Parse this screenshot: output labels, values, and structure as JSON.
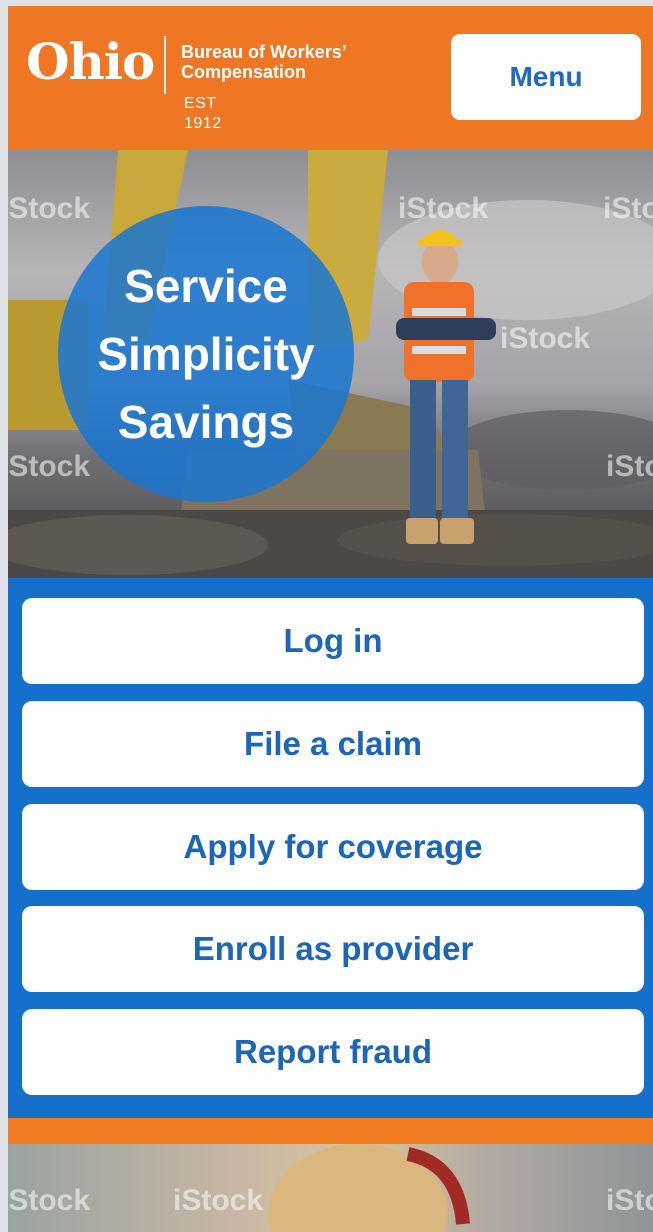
{
  "header": {
    "logo": {
      "name": "Ohio",
      "line1": "Bureau of Workers’",
      "line2": "Compensation",
      "est": "EST 1912"
    },
    "menu_label": "Menu"
  },
  "hero": {
    "taglines": [
      "Service",
      "Simplicity",
      "Savings"
    ],
    "watermark": "iStock"
  },
  "actions": [
    {
      "label": "Log in"
    },
    {
      "label": "File a claim"
    },
    {
      "label": "Apply for coverage"
    },
    {
      "label": "Enroll as provider"
    },
    {
      "label": "Report fraud"
    }
  ],
  "colors": {
    "brand_orange": "#ef7622",
    "brand_blue": "#1570cc",
    "button_text": "#1b66b8"
  }
}
